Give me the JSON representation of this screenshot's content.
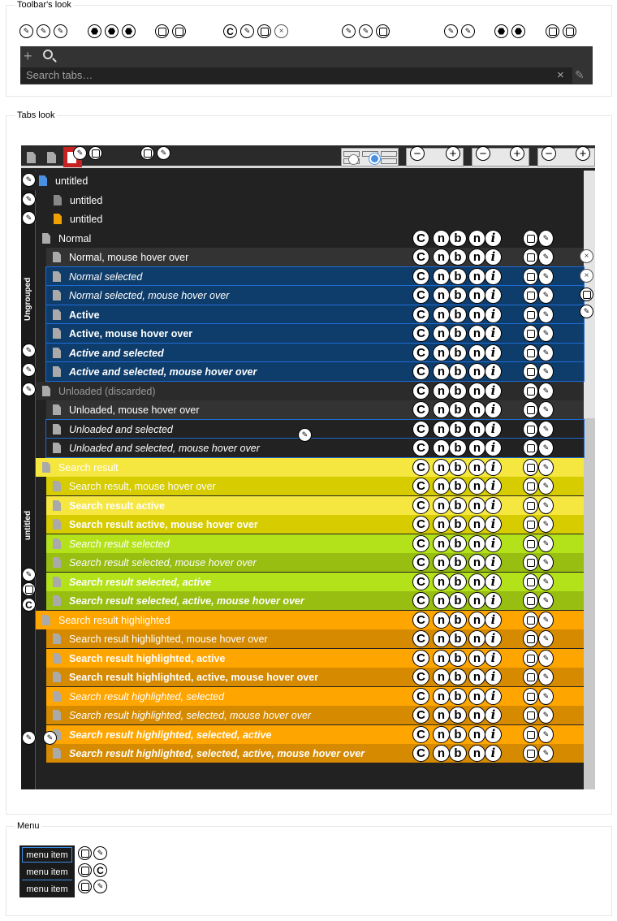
{
  "sections": {
    "toolbar": "Toolbar's look",
    "tabs": "Tabs look",
    "menu": "Menu"
  },
  "toolbar": {
    "plus_icon": "plus-icon",
    "search_icon": "search-icon",
    "search_placeholder": "Search tabs…",
    "clear_icon": "close-icon",
    "edit_icon": "pencil-icon"
  },
  "tabs": {
    "groups": [
      "Ungrouped",
      "untitled"
    ],
    "rows": [
      {
        "label": "untitled",
        "style": "plain",
        "bg": "#222222",
        "color": "#ffffff"
      },
      {
        "label": "untitled",
        "style": "plain",
        "bg": "#222222",
        "color": "#ffffff"
      },
      {
        "label": "untitled",
        "style": "plain",
        "bg": "#222222",
        "color": "#ffffff"
      },
      {
        "label": "Normal",
        "style": "plain",
        "bg": "#222222",
        "color": "#ffffff"
      },
      {
        "label": "Normal, mouse hover over",
        "style": "plain",
        "bg": "#333333",
        "color": "#ffffff"
      },
      {
        "label": "Normal selected",
        "style": "italic",
        "bg": "#0f3d6b",
        "color": "#ffffff"
      },
      {
        "label": "Normal selected, mouse hover over",
        "style": "italic",
        "bg": "#0f3d6b",
        "color": "#ffffff"
      },
      {
        "label": "Active",
        "style": "bold",
        "bg": "#0f3d6b",
        "color": "#ffffff"
      },
      {
        "label": "Active, mouse hover over",
        "style": "bold",
        "bg": "#0f3d6b",
        "color": "#ffffff"
      },
      {
        "label": "Active and selected",
        "style": "bolditalic",
        "bg": "#0f3d6b",
        "color": "#ffffff"
      },
      {
        "label": "Active and selected, mouse hover over",
        "style": "bolditalic",
        "bg": "#0f3d6b",
        "color": "#ffffff"
      },
      {
        "label": "Unloaded (discarded)",
        "style": "plain",
        "bg": "#2b2b2b",
        "color": "#9a9a9a"
      },
      {
        "label": "Unloaded, mouse hover over",
        "style": "plain",
        "bg": "#333333",
        "color": "#ffffff"
      },
      {
        "label": "Unloaded and selected",
        "style": "italic",
        "bg": "#222222",
        "color": "#ffffff"
      },
      {
        "label": "Unloaded and selected, mouse hover over",
        "style": "italic",
        "bg": "#222222",
        "color": "#ffffff"
      },
      {
        "label": "Search result",
        "style": "plain",
        "bg": "#f5e640",
        "color": "#ffffff"
      },
      {
        "label": "Search result, mouse hover over",
        "style": "plain",
        "bg": "#d6cc00",
        "color": "#ffffff"
      },
      {
        "label": "Search result active",
        "style": "bold",
        "bg": "#f5e640",
        "color": "#ffffff"
      },
      {
        "label": "Search result active, mouse hover over",
        "style": "bold",
        "bg": "#d6cc00",
        "color": "#ffffff"
      },
      {
        "label": "Search result selected",
        "style": "italic",
        "bg": "#b4e21a",
        "color": "#ffffff"
      },
      {
        "label": "Search result selected, mouse hover over",
        "style": "italic",
        "bg": "#97be10",
        "color": "#ffffff"
      },
      {
        "label": "Search result selected, active",
        "style": "bolditalic",
        "bg": "#b4e21a",
        "color": "#ffffff"
      },
      {
        "label": "Search result selected, active, mouse hover over",
        "style": "bolditalic",
        "bg": "#97be10",
        "color": "#ffffff"
      },
      {
        "label": "Search result highlighted",
        "style": "plain",
        "bg": "#ffa500",
        "color": "#ffffff"
      },
      {
        "label": "Search result highlighted, mouse hover over",
        "style": "plain",
        "bg": "#d68a00",
        "color": "#ffffff"
      },
      {
        "label": "Search result highlighted, active",
        "style": "bold",
        "bg": "#ffa500",
        "color": "#ffffff"
      },
      {
        "label": "Search result highlighted, active, mouse hover over",
        "style": "bold",
        "bg": "#d68a00",
        "color": "#ffffff"
      },
      {
        "label": "Search result highlighted, selected",
        "style": "italic",
        "bg": "#ffa500",
        "color": "#ffffff"
      },
      {
        "label": "Search result highlighted, selected, mouse hover over",
        "style": "italic",
        "bg": "#d68a00",
        "color": "#ffffff"
      },
      {
        "label": "Search result highlighted, selected, active",
        "style": "bolditalic",
        "bg": "#ffa500",
        "color": "#ffffff"
      },
      {
        "label": "Search result highlighted, selected, active, mouse hover over",
        "style": "bolditalic",
        "bg": "#d68a00",
        "color": "#ffffff"
      }
    ]
  },
  "menu": {
    "items": [
      "menu item",
      "menu item",
      "menu item"
    ]
  },
  "colors": {
    "accent_blue": "#1e6bd6",
    "close_red": "#d22222",
    "dark_bg": "#222222"
  }
}
